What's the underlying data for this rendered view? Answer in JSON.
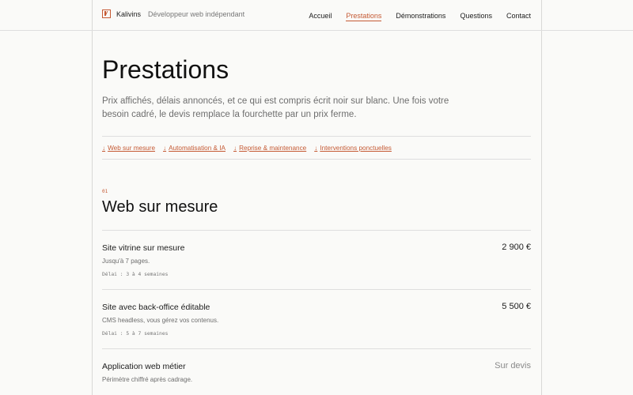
{
  "header": {
    "brand_name": "Kalivins",
    "brand_tagline": "Développeur web indépendant",
    "nav": [
      {
        "label": "Accueil",
        "active": false
      },
      {
        "label": "Prestations",
        "active": true
      },
      {
        "label": "Démonstrations",
        "active": false
      },
      {
        "label": "Questions",
        "active": false
      },
      {
        "label": "Contact",
        "active": false
      }
    ]
  },
  "page": {
    "title": "Prestations",
    "intro": "Prix affichés, délais annoncés, et ce qui est compris écrit noir sur blanc. Une fois votre besoin cadré, le devis remplace la fourchette par un prix ferme."
  },
  "anchors": [
    {
      "arrow": "↓",
      "label": "Web sur mesure"
    },
    {
      "arrow": "↓",
      "label": "Automatisation & IA"
    },
    {
      "arrow": "↓",
      "label": "Reprise & maintenance"
    },
    {
      "arrow": "↓",
      "label": "Interventions ponctuelles"
    }
  ],
  "section": {
    "number": "01",
    "title": "Web sur mesure",
    "services": [
      {
        "name": "Site vitrine sur mesure",
        "description": "Jusqu'à 7 pages.",
        "delay": "Délai : 3 à 4 semaines",
        "price": "2 900 €"
      },
      {
        "name": "Site avec back-office éditable",
        "description": "CMS headless, vous gérez vos contenus.",
        "delay": "Délai : 5 à 7 semaines",
        "price": "5 500 €"
      },
      {
        "name": "Application web métier",
        "description": "Périmètre chiffré après cadrage.",
        "delay": "",
        "price": "Sur devis"
      }
    ]
  },
  "colors": {
    "accent": "#c55a34",
    "background": "#fafaf8",
    "divider": "#dedede"
  },
  "icons": {
    "logo": "kalivins-logo-icon",
    "anchor_arrow": "arrow-down-icon"
  }
}
